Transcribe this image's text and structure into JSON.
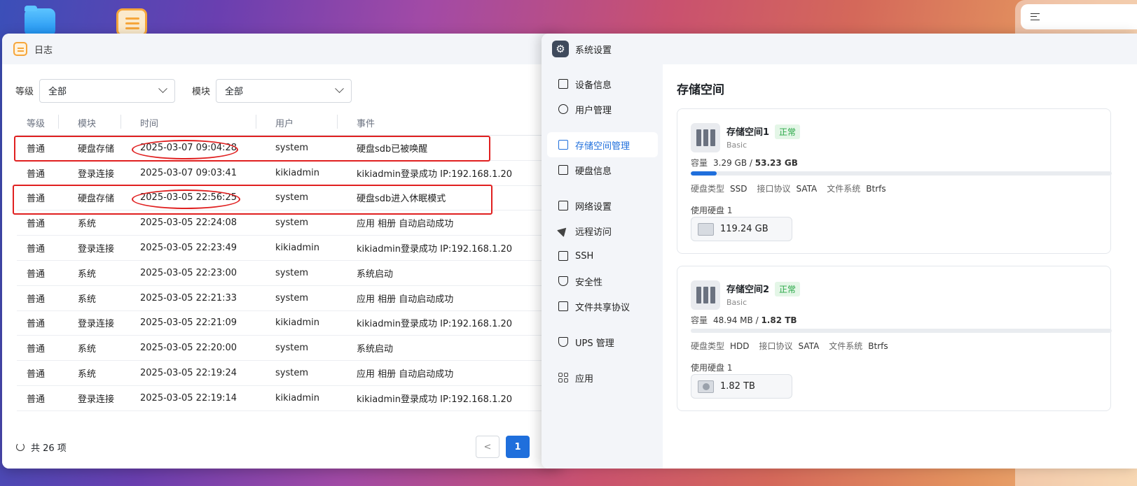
{
  "log_window": {
    "title": "日志",
    "filters": {
      "level_label": "等级",
      "level_value": "全部",
      "module_label": "模块",
      "module_value": "全部"
    },
    "columns": [
      "等级",
      "模块",
      "时间",
      "用户",
      "事件"
    ],
    "rows": [
      [
        "普通",
        "硬盘存储",
        "2025-03-07 09:04:28",
        "system",
        "硬盘sdb已被唤醒"
      ],
      [
        "普通",
        "登录连接",
        "2025-03-07 09:03:41",
        "kikiadmin",
        "kikiadmin登录成功 IP:192.168.1.20"
      ],
      [
        "普通",
        "硬盘存储",
        "2025-03-05 22:56:25",
        "system",
        "硬盘sdb进入休眠模式"
      ],
      [
        "普通",
        "系统",
        "2025-03-05 22:24:08",
        "system",
        "应用 相册 自动启动成功"
      ],
      [
        "普通",
        "登录连接",
        "2025-03-05 22:23:49",
        "kikiadmin",
        "kikiadmin登录成功 IP:192.168.1.20"
      ],
      [
        "普通",
        "系统",
        "2025-03-05 22:23:00",
        "system",
        "系统启动"
      ],
      [
        "普通",
        "系统",
        "2025-03-05 22:21:33",
        "system",
        "应用 相册 自动启动成功"
      ],
      [
        "普通",
        "登录连接",
        "2025-03-05 22:21:09",
        "kikiadmin",
        "kikiadmin登录成功 IP:192.168.1.20"
      ],
      [
        "普通",
        "系统",
        "2025-03-05 22:20:00",
        "system",
        "系统启动"
      ],
      [
        "普通",
        "系统",
        "2025-03-05 22:19:24",
        "system",
        "应用 相册 自动启动成功"
      ],
      [
        "普通",
        "登录连接",
        "2025-03-05 22:19:14",
        "kikiadmin",
        "kikiadmin登录成功 IP:192.168.1.20"
      ]
    ],
    "footer": {
      "total": "共 26 项",
      "page": "1",
      "prev": "<"
    }
  },
  "settings_window": {
    "title": "系统设置",
    "nav": [
      {
        "label": "设备信息",
        "icon": "device-icon"
      },
      {
        "label": "用户管理",
        "icon": "user-icon"
      },
      {
        "label": "存储空间管理",
        "icon": "storage-icon",
        "active": true
      },
      {
        "label": "硬盘信息",
        "icon": "disk-icon"
      },
      {
        "label": "网络设置",
        "icon": "network-icon"
      },
      {
        "label": "远程访问",
        "icon": "send-icon"
      },
      {
        "label": "SSH",
        "icon": "terminal-icon"
      },
      {
        "label": "安全性",
        "icon": "shield-icon"
      },
      {
        "label": "文件共享协议",
        "icon": "file-icon"
      },
      {
        "label": "UPS 管理",
        "icon": "ups-icon"
      },
      {
        "label": "应用",
        "icon": "apps-icon"
      }
    ],
    "heading": "存储空间",
    "pools": [
      {
        "name": "存储空间1",
        "status": "正常",
        "type": "Basic",
        "capacity_label": "容量",
        "used": "3.29 GB",
        "total": "53.23 GB",
        "usage_fraction": 0.062,
        "disk_type_label": "硬盘类型",
        "disk_type": "SSD",
        "interface_label": "接口协议",
        "interface": "SATA",
        "fs_label": "文件系统",
        "fs": "Btrfs",
        "disks_label": "使用硬盘 1",
        "disk_size": "119.24 GB"
      },
      {
        "name": "存储空间2",
        "status": "正常",
        "type": "Basic",
        "capacity_label": "容量",
        "used": "48.94 MB",
        "total": "1.82 TB",
        "usage_fraction": 0.0,
        "disk_type_label": "硬盘类型",
        "disk_type": "HDD",
        "interface_label": "接口协议",
        "interface": "SATA",
        "fs_label": "文件系统",
        "fs": "Btrfs",
        "disks_label": "使用硬盘 1",
        "disk_size": "1.82 TB"
      }
    ]
  },
  "colors": {
    "accent": "#1f6fdc",
    "status_ok": "#27a745",
    "annotation": "#e02020"
  }
}
